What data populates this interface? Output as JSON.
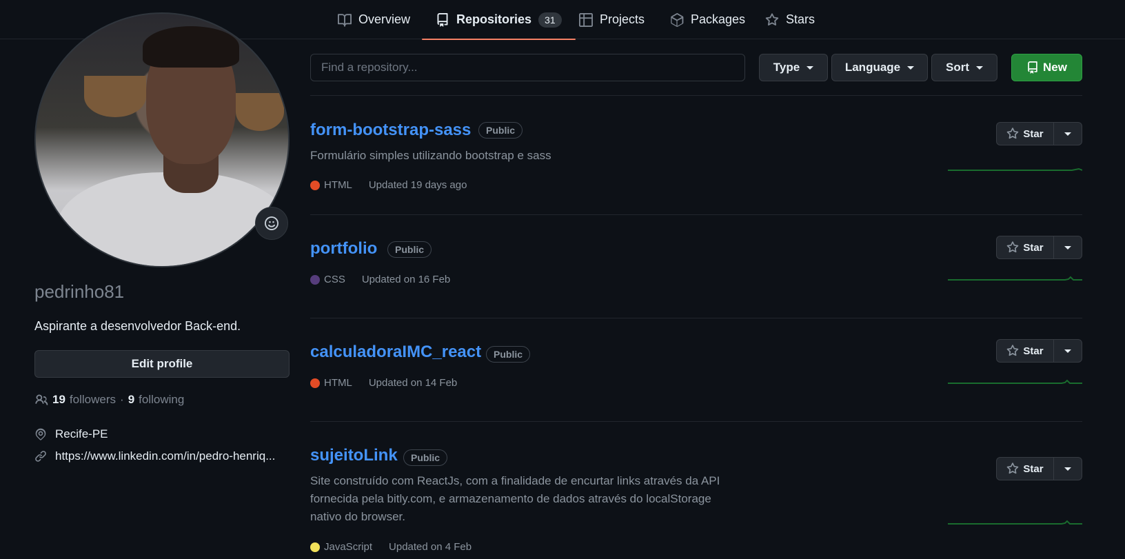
{
  "nav": {
    "tabs": [
      {
        "label": "Overview",
        "icon": "book-icon"
      },
      {
        "label": "Repositories",
        "icon": "repo-icon",
        "count": "31"
      },
      {
        "label": "Projects",
        "icon": "table-icon"
      },
      {
        "label": "Packages",
        "icon": "package-icon"
      },
      {
        "label": "Stars",
        "icon": "star-icon"
      }
    ]
  },
  "profile": {
    "username": "pedrinho81",
    "bio": "Aspirante a desenvolvedor Back-end.",
    "edit_label": "Edit profile",
    "followers_count": "19",
    "followers_label": "followers",
    "separator": "·",
    "following_count": "9",
    "following_label": "following",
    "location": "Recife-PE",
    "link": "https://www.linkedin.com/in/pedro-henriq..."
  },
  "filters": {
    "search_placeholder": "Find a repository...",
    "type_label": "Type",
    "language_label": "Language",
    "sort_label": "Sort",
    "new_label": "New"
  },
  "repos": [
    {
      "name": "form-bootstrap-sass",
      "visibility": "Public",
      "description": "Formulário simples utilizando bootstrap e sass",
      "language": "HTML",
      "lang_color": "#e34c26",
      "updated": "Updated 19 days ago",
      "star_label": "Star"
    },
    {
      "name": "portfolio",
      "visibility": "Public",
      "description": "",
      "language": "CSS",
      "lang_color": "#563d7c",
      "updated": "Updated on 16 Feb",
      "star_label": "Star"
    },
    {
      "name": "calculadoraIMC_react",
      "visibility": "Public",
      "description": "",
      "language": "HTML",
      "lang_color": "#e34c26",
      "updated": "Updated on 14 Feb",
      "star_label": "Star"
    },
    {
      "name": "sujeitoLink",
      "visibility": "Public",
      "description_lines": [
        "Site construído com ReactJs, com a finalidade de encurtar links através da API",
        "fornecida pela bitly.com, e armazenamento de dados através do localStorage",
        "nativo do browser."
      ],
      "language": "JavaScript",
      "lang_color": "#f1e05a",
      "updated": "Updated on 4 Feb",
      "star_label": "Star"
    }
  ],
  "colors": {
    "background": "#0d1117",
    "link": "#4493f8",
    "active_tab_underline": "#f78166",
    "new_button": "#238636",
    "sparkline": "#196c2e"
  }
}
